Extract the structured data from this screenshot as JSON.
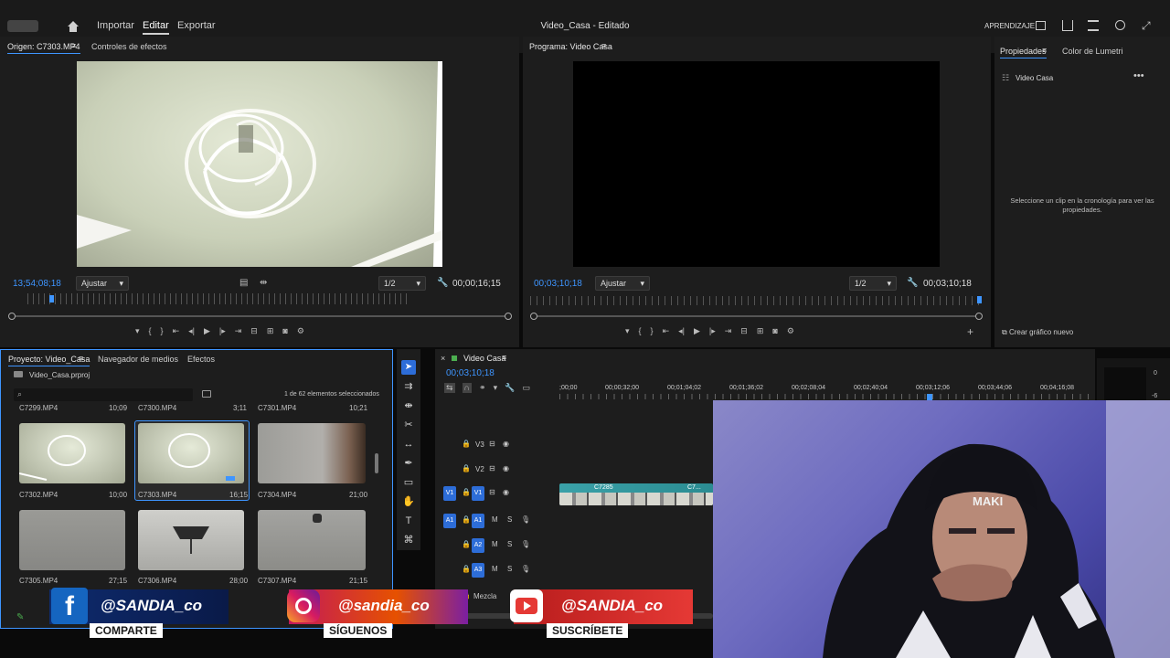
{
  "app": {
    "title": "Video_Casa - Editado",
    "menu": [
      "Importar",
      "Editar",
      "Exportar"
    ],
    "right_label": "APRENDIZAJE"
  },
  "source_monitor": {
    "tab_source": "Origen: C7303.MP4",
    "tab_effects": "Controles de efectos",
    "timecode_left": "13;54;08;18",
    "fit": "Ajustar",
    "resolution": "1/2",
    "timecode_right": "00;00;16;15"
  },
  "program_monitor": {
    "tab": "Programa: Video Casa",
    "timecode_left": "00;03;10;18",
    "fit": "Ajustar",
    "resolution": "1/2",
    "timecode_right": "00;03;10;18"
  },
  "properties": {
    "tab_properties": "Propiedades",
    "tab_lumetri": "Color de Lumetri",
    "sequence_name": "Video Casa",
    "message": "Seleccione un clip en la cronología para ver las propiedades.",
    "new_graphic": "Crear gráfico nuevo"
  },
  "project": {
    "tab_project": "Proyecto: Video_Casa",
    "tab_media": "Navegador de medios",
    "tab_effects": "Efectos",
    "file": "Video_Casa.prproj",
    "selection_count": "1 de 62 elementos seleccionados",
    "top_row_names": [
      "C7299.MP4",
      "C7300.MP4",
      "C7301.MP4"
    ],
    "top_row_durations": [
      "10;09",
      "3;11",
      "10;21"
    ],
    "clips": [
      {
        "name": "C7302.MP4",
        "duration": "10;00"
      },
      {
        "name": "C7303.MP4",
        "duration": "16;15"
      },
      {
        "name": "C7304.MP4",
        "duration": "21;00"
      },
      {
        "name": "C7305.MP4",
        "duration": "27;15"
      },
      {
        "name": "C7306.MP4",
        "duration": "28;00"
      },
      {
        "name": "C7307.MP4",
        "duration": "21;15"
      }
    ]
  },
  "timeline": {
    "tab": "Video Casa",
    "timecode": "00;03;10;18",
    "ruler": [
      ";00;00",
      "00;00;32;00",
      "00;01;04;02",
      "00;01;36;02",
      "00;02;08;04",
      "00;02;40;04",
      "00;03;12;06",
      "00;03;44;06",
      "00;04;16;08"
    ],
    "video_tracks": [
      "V3",
      "V2",
      "V1"
    ],
    "audio_tracks": [
      "A1",
      "A2",
      "A3"
    ],
    "mix_label": "Mezcla",
    "clip_labels": [
      "C7285",
      "C7..."
    ],
    "meter_labels": [
      "0",
      "-6"
    ]
  },
  "social": [
    {
      "handle": "@SANDIA_co",
      "action": "COMPARTE",
      "icon": "facebook-icon"
    },
    {
      "handle": "@sandia_co",
      "action": "SÍGUENOS",
      "icon": "instagram-icon"
    },
    {
      "handle": "@SANDIA_co",
      "action": "SUSCRÍBETE",
      "icon": "youtube-icon"
    }
  ],
  "webcam": {
    "cap_text": "MAKI"
  }
}
